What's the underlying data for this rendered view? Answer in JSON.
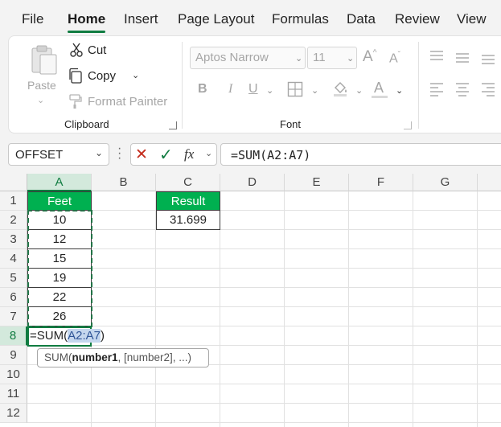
{
  "ribbon_tabs": [
    "File",
    "Home",
    "Insert",
    "Page Layout",
    "Formulas",
    "Data",
    "Review",
    "View"
  ],
  "active_tab": "Home",
  "clipboard": {
    "paste_label": "Paste",
    "cut_label": "Cut",
    "copy_label": "Copy",
    "format_painter_label": "Format Painter",
    "group_label": "Clipboard"
  },
  "font": {
    "font_name": "Aptos Narrow",
    "font_size": "11",
    "bold": "B",
    "italic": "I",
    "underline": "U",
    "group_label": "Font"
  },
  "formula_bar": {
    "name_box": "OFFSET",
    "cancel_symbol": "✕",
    "enter_symbol": "✓",
    "fx_label": "fx",
    "formula": "=SUM(A2:A7)"
  },
  "columns": [
    "A",
    "B",
    "C",
    "D",
    "E",
    "F",
    "G"
  ],
  "rows": [
    "1",
    "2",
    "3",
    "4",
    "5",
    "6",
    "7",
    "8",
    "9",
    "10",
    "11",
    "12"
  ],
  "cells": {
    "A1": "Feet",
    "A2": "10",
    "A3": "12",
    "A4": "15",
    "A5": "19",
    "A6": "22",
    "A7": "26",
    "C1": "Result",
    "C2": "31.699"
  },
  "edit_cell": {
    "prefix": "=SUM(",
    "reference": "A2:A7",
    "suffix": ")"
  },
  "tooltip": {
    "fn": "SUM(",
    "arg1": "number1",
    "rest": ", [number2], ...)"
  },
  "colors": {
    "accent_green": "#107c41",
    "header_fill": "#00b050",
    "reference_blue": "#2f5597"
  }
}
